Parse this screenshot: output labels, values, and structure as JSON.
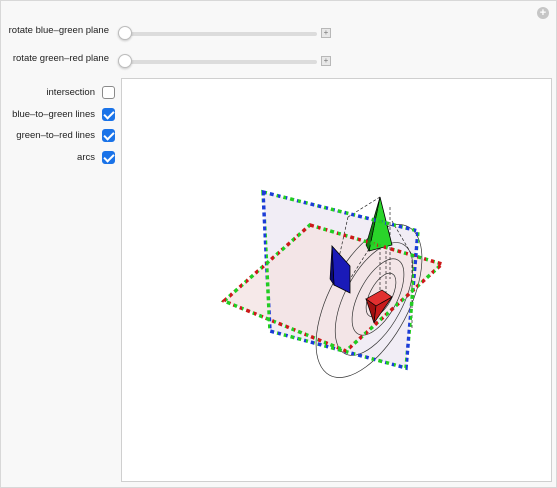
{
  "sliders": [
    {
      "label": "rotate blue–green plane",
      "value": 0
    },
    {
      "label": "rotate green–red plane",
      "value": 0
    }
  ],
  "checkboxes": [
    {
      "label": "intersection",
      "checked": false
    },
    {
      "label": "blue–to–green lines",
      "checked": true
    },
    {
      "label": "green–to–red lines",
      "checked": true
    },
    {
      "label": "arcs",
      "checked": true
    }
  ],
  "colors": {
    "accent": "#1a73e8",
    "blue": "#1010b0",
    "green": "#22cc22",
    "red": "#cc1a1a"
  }
}
